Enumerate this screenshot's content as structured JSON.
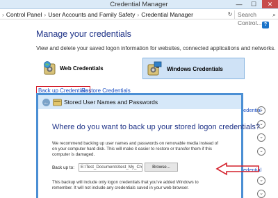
{
  "window": {
    "title": "Credential Manager",
    "min": "—",
    "max": "☐",
    "close": "✕"
  },
  "address": {
    "crumbs": [
      "Control Panel",
      "User Accounts and Family Safety",
      "Credential Manager"
    ],
    "refresh": "↻",
    "search_placeholder": "Search Control..."
  },
  "help": "?",
  "main": {
    "heading": "Manage your credentials",
    "subtitle": "View and delete your saved logon information for websites, connected applications and networks.",
    "tiles": {
      "web": "Web Credentials",
      "windows": "Windows Credentials"
    },
    "links": {
      "backup": "Back up Credentials",
      "restore": "Restore Credentials"
    },
    "side": {
      "top_frag": "edential",
      "bottom_frag": "edential",
      "expand": "⌄"
    }
  },
  "dialog": {
    "title": "Stored User Names and Passwords",
    "question": "Where do you want to back up your stored logon credentials?",
    "para1": "We recommend backing up user names and passwords on removable media instead of on your computer hard disk. This will make it easier to restore or transfer them if this computer is damaged.",
    "backup_to_label": "Back up to:",
    "path_value": "E:\\Test_Documents\\test_My_Credents",
    "browse": "Browse...",
    "para2": "This backup will include only logon credentials that you've added Windows to remember. It will not include any credentials saved in your web browser."
  },
  "colors": {
    "accent": "#1e3287",
    "link": "#1b4ec2",
    "highlight_box": "#d4202c",
    "dialog_border": "#4b8fd4"
  }
}
